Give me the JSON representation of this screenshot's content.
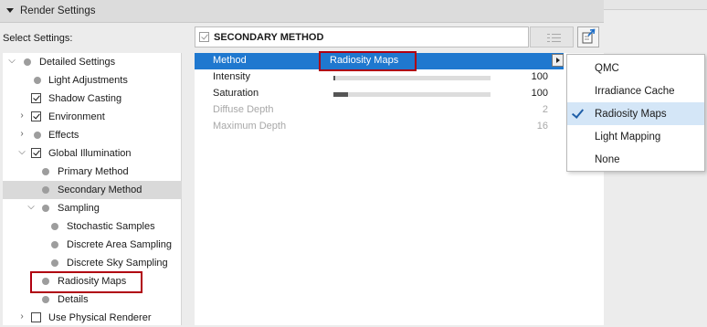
{
  "panel": {
    "title": "Render Settings"
  },
  "select_settings": {
    "label": "Select Settings:",
    "current": "SECONDARY METHOD"
  },
  "tree": [
    {
      "label": "Detailed Settings",
      "control": "dot",
      "expanded": true
    },
    {
      "label": "Light Adjustments",
      "control": "dot"
    },
    {
      "label": "Shadow Casting",
      "control": "checkbox",
      "checked": true
    },
    {
      "label": "Environment",
      "control": "checkbox",
      "checked": true,
      "expandable": true
    },
    {
      "label": "Effects",
      "control": "dot",
      "expandable": true
    },
    {
      "label": "Global Illumination",
      "control": "checkbox",
      "checked": true,
      "expanded": true
    },
    {
      "label": "Primary Method",
      "control": "dot"
    },
    {
      "label": "Secondary Method",
      "control": "dot",
      "selected": true
    },
    {
      "label": "Sampling",
      "control": "dot",
      "expanded": true
    },
    {
      "label": "Stochastic Samples",
      "control": "dot"
    },
    {
      "label": "Discrete Area Sampling",
      "control": "dot"
    },
    {
      "label": "Discrete Sky Sampling",
      "control": "dot"
    },
    {
      "label": "Radiosity Maps",
      "control": "dot",
      "highlighted": true
    },
    {
      "label": "Details",
      "control": "dot"
    },
    {
      "label": "Use Physical Renderer",
      "control": "checkbox",
      "checked": false,
      "expandable": true
    }
  ],
  "properties": [
    {
      "name": "Method",
      "value": "Radiosity Maps",
      "type": "dropdown",
      "selected": true
    },
    {
      "name": "Intensity",
      "value": "100",
      "type": "slider",
      "fill": 0.01
    },
    {
      "name": "Saturation",
      "value": "100",
      "type": "slider",
      "fill": 0.09
    },
    {
      "name": "Diffuse Depth",
      "value": "2",
      "type": "number",
      "disabled": true
    },
    {
      "name": "Maximum Depth",
      "value": "16",
      "type": "number",
      "disabled": true
    }
  ],
  "method_menu": {
    "options": [
      "QMC",
      "Irradiance Cache",
      "Radiosity Maps",
      "Light Mapping",
      "None"
    ],
    "checked": "Radiosity Maps"
  },
  "colors": {
    "selection_blue": "#1f78cf",
    "highlight_red": "#b00010",
    "menu_checked_bg": "#d4e6f7"
  }
}
